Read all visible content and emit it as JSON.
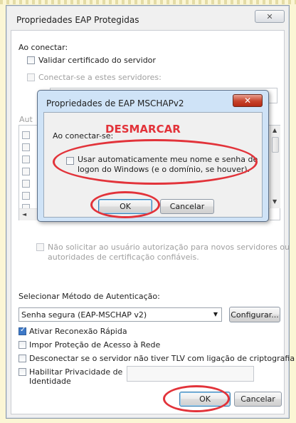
{
  "window": {
    "title": "Propriedades EAP Protegidas",
    "close_glyph": "✕"
  },
  "connect_section": {
    "label": "Ao conectar:",
    "validate_cert": {
      "label": "Validar certificado do servidor",
      "checked": false
    },
    "connect_servers": {
      "label": "Conectar-se a estes servidores:",
      "checked": false,
      "value": ""
    },
    "authorities_label": "Aut",
    "no_prompt": {
      "label_line1": "Não solicitar ao usuário autorização para novos servidores ou",
      "label_line2": "autoridades de certificação confiáveis.",
      "checked": false
    }
  },
  "auth_method": {
    "label": "Selecionar Método de Autenticação:",
    "selected": "Senha segura (EAP-MSCHAP v2)",
    "configure_button": "Configurar..."
  },
  "options": [
    {
      "label": "Ativar Reconexão Rápida",
      "checked": true
    },
    {
      "label": "Impor Proteção de Acesso à Rede",
      "checked": false
    },
    {
      "label": "Desconectar se o servidor não tiver TLV com ligação de criptografia",
      "checked": false
    }
  ],
  "privacy": {
    "label_line1": "Habilitar Privacidade de",
    "label_line2": "Identidade",
    "checked": false,
    "value": ""
  },
  "buttons": {
    "ok": "OK",
    "cancel": "Cancelar"
  },
  "inner_dialog": {
    "title": "Propriedades de EAP MSCHAPv2",
    "close_glyph": "✕",
    "connect_label": "Ao conectar-se:",
    "auto_login": {
      "label_line1": "Usar automaticamente meu nome e senha de",
      "label_line2": "logon do Windows (e o domínio, se houver).",
      "checked": false
    },
    "ok": "OK",
    "cancel": "Cancelar"
  },
  "annotation": {
    "text": "DESMARCAR",
    "color": "#e2333a"
  }
}
